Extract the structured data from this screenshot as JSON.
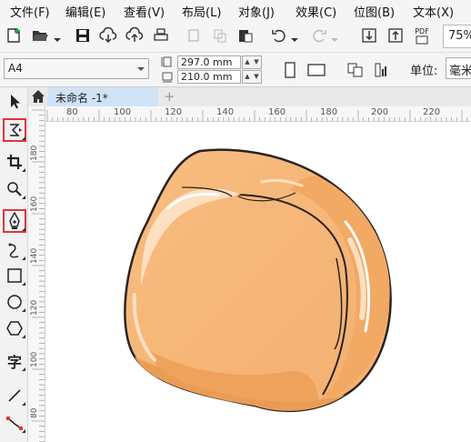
{
  "menu": {
    "items": [
      "文件(F)",
      "编辑(E)",
      "查看(V)",
      "布局(L)",
      "对象(J)",
      "效果(C)",
      "位图(B)",
      "文本(X)"
    ]
  },
  "toolbar": {
    "zoom": "75%",
    "pdf_label": "PDF"
  },
  "property_bar": {
    "page_size": "A4",
    "height_value": "297.0 mm",
    "width_value": "210.0 mm",
    "unit_label": "单位:",
    "unit_value": "毫米"
  },
  "tabs": {
    "document_tab": "未命名 -1*",
    "new_tab": "+"
  },
  "rulers": {
    "horizontal_ticks": [
      "80",
      "100",
      "120",
      "140",
      "160",
      "180",
      "200",
      "220"
    ],
    "vertical_ticks": [
      "180",
      "160",
      "140",
      "120",
      "100",
      "80"
    ]
  },
  "tools": [
    "pick-tool",
    "shape-tool",
    "crop-tool",
    "zoom-tool",
    "pen-tool",
    "bspline-tool",
    "rectangle-tool",
    "ellipse-tool",
    "polygon-tool",
    "text-tool",
    "line-tool",
    "connector-tool"
  ],
  "colors": {
    "highlight": "#e0343a",
    "peach_fill": "#f7b877",
    "peach_shadow": "#ea9c55",
    "peach_outline": "#2b2220"
  }
}
